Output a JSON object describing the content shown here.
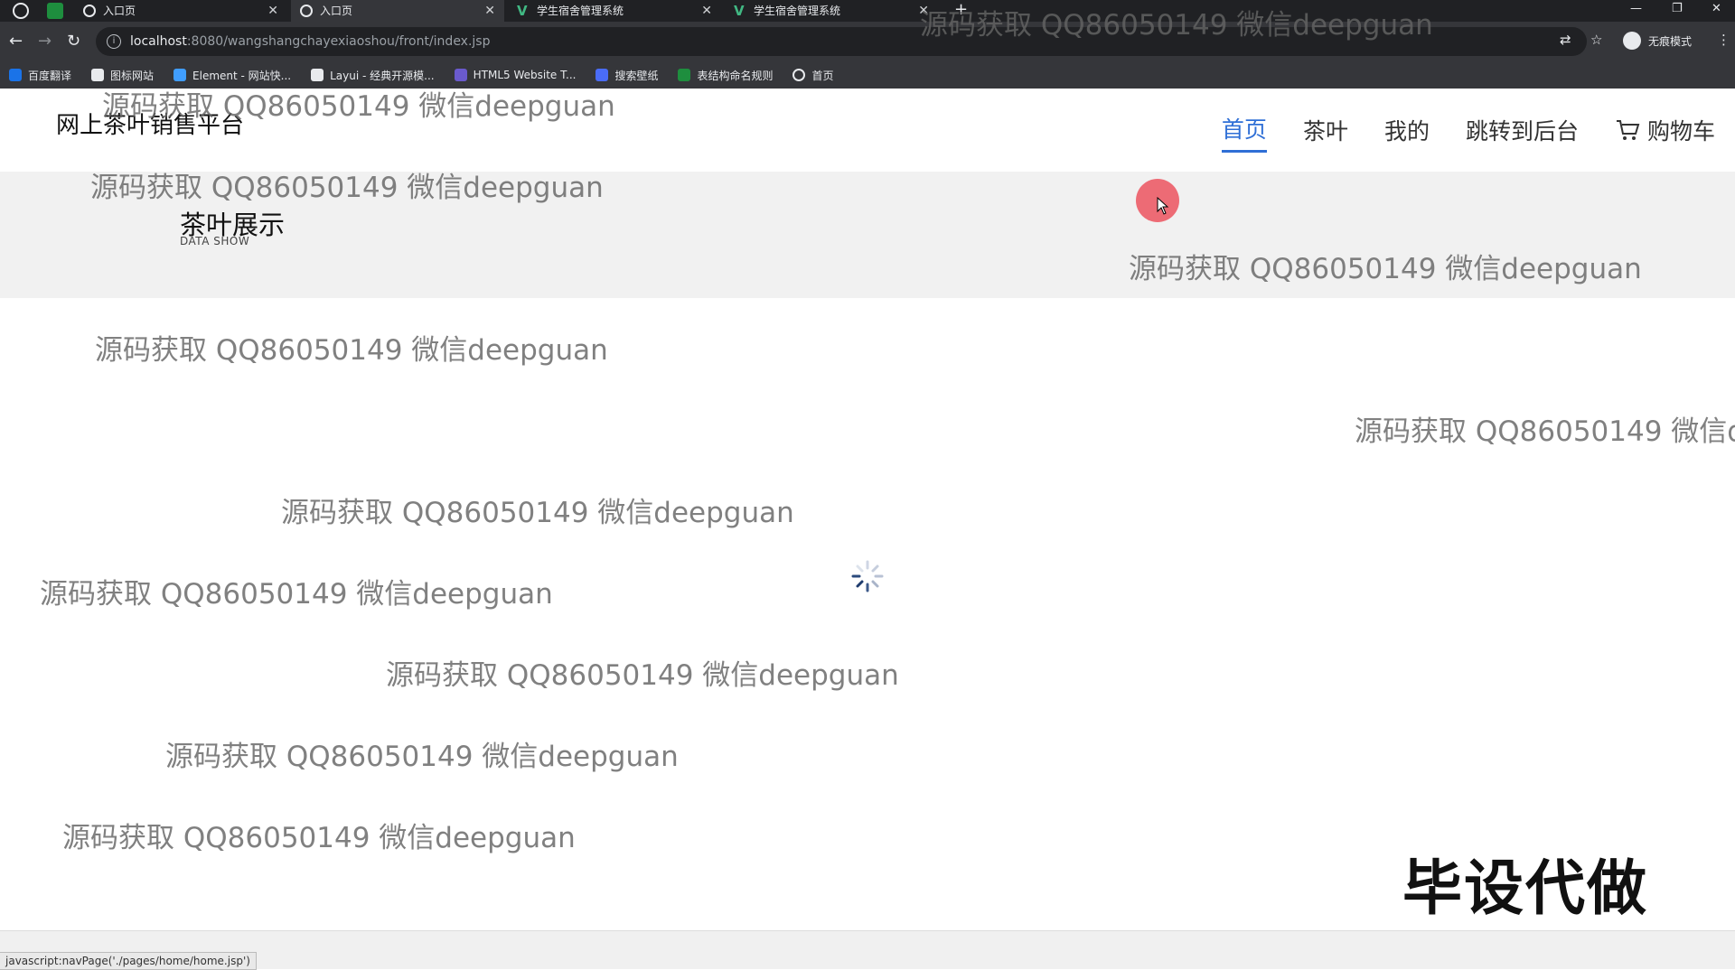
{
  "browser": {
    "tabs": [
      {
        "label": "入口页",
        "active": false
      },
      {
        "label": "入口页",
        "active": true
      },
      {
        "label": "学生宿舍管理系统",
        "active": false
      },
      {
        "label": "学生宿舍管理系统",
        "active": false
      }
    ],
    "url_host": "localhost",
    "url_path": ":8080/wangshangchayexiaoshou/front/index.jsp",
    "incognito_label": "无痕模式",
    "bookmarks": [
      {
        "label": "百度翻译",
        "icon": "translate-icon",
        "color": "#1a73e8"
      },
      {
        "label": "图标网站",
        "icon": "flag-icon",
        "color": "#e8eaed"
      },
      {
        "label": "Element - 网站快...",
        "icon": "element-icon",
        "color": "#409eff"
      },
      {
        "label": "Layui - 经典开源模...",
        "icon": "layui-icon",
        "color": "#e8eaed"
      },
      {
        "label": "HTML5 Website T...",
        "icon": "html5-icon",
        "color": "#6a5acd"
      },
      {
        "label": "搜索壁纸",
        "icon": "wallpaper-icon",
        "color": "#4a6cf7"
      },
      {
        "label": "表结构命名规则",
        "icon": "sheet-icon",
        "color": "#1e8e3e"
      },
      {
        "label": "首页",
        "icon": "globe-icon",
        "color": "#e8eaed"
      }
    ],
    "status_url": "javascript:navPage('./pages/home/home.jsp')"
  },
  "site": {
    "title": "网上茶叶销售平台",
    "nav": [
      {
        "label": "首页",
        "active": true
      },
      {
        "label": "茶叶",
        "active": false
      },
      {
        "label": "我的",
        "active": false
      },
      {
        "label": "跳转到后台",
        "active": false
      },
      {
        "label": "购物车",
        "active": false
      }
    ]
  },
  "banner": {
    "title": "茶叶展示",
    "subtitle": "DATA SHOW"
  },
  "watermark_text": "源码获取 QQ86050149 微信deepguan",
  "stamp_text": "毕设代做",
  "colors": {
    "accent": "#2f6fd6",
    "chrome_dark": "#202124",
    "chrome_mid": "#35363a",
    "cursor_highlight": "#ec545f"
  }
}
